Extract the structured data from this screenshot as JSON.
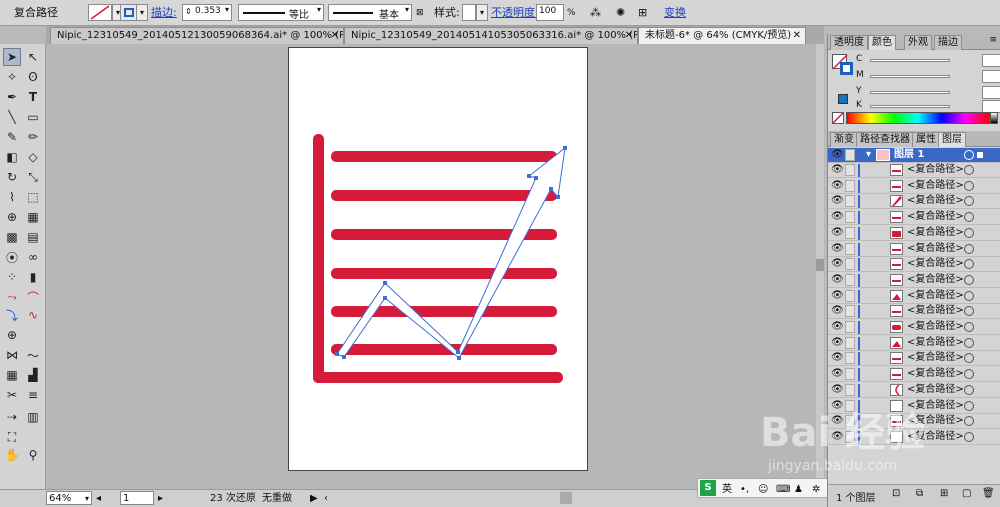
{
  "control": {
    "object_type": "复合路径",
    "stroke_label": "描边:",
    "stroke_weight": "0.353",
    "profile_label": "等比",
    "brush_label": "基本",
    "style_label": "样式:",
    "opacity_label": "不透明度:",
    "opacity_value": "100",
    "opacity_unit": "%",
    "transform_label": "变换"
  },
  "tabs": [
    {
      "label": "Nipic_12310549_20140512130059068364.ai* @ 100% (R..."
    },
    {
      "label": "Nipic_12310549_20140514105305063316.ai* @ 100% (R..."
    },
    {
      "label": "未标题-6* @ 64% (CMYK/预览)"
    }
  ],
  "status": {
    "zoom": "64%",
    "page": "1",
    "undo": "23 次还原",
    "redo": "无重做",
    "ime": "英"
  },
  "panel": {
    "top_tabs": [
      "透明度",
      "颜色",
      "外观",
      "描边"
    ],
    "channels": [
      "C",
      "M",
      "Y",
      "K"
    ],
    "bottom_tabs": [
      "渐变",
      "路径查找器",
      "属性",
      "图层"
    ],
    "layer_name": "图层 1",
    "sublayers": [
      "<复合路径>",
      "<复合路径>",
      "<复合路径>",
      "<复合路径>",
      "<复合路径>",
      "<复合路径>",
      "<复合路径>",
      "<复合路径>",
      "<复合路径>",
      "<复合路径>",
      "<复合路径>",
      "<复合路径>",
      "<复合路径>",
      "<复合路径>",
      "<复合路径>",
      "<复合路径>",
      "<复合路径>",
      "<复合路径>"
    ],
    "layer_count": "1 个图层"
  },
  "watermark": {
    "brand": "Bai 经验",
    "url": "jingyan.baidu.com"
  },
  "colors": {
    "art_red": "#d51a3a",
    "selection_blue": "#3f6ed8"
  }
}
